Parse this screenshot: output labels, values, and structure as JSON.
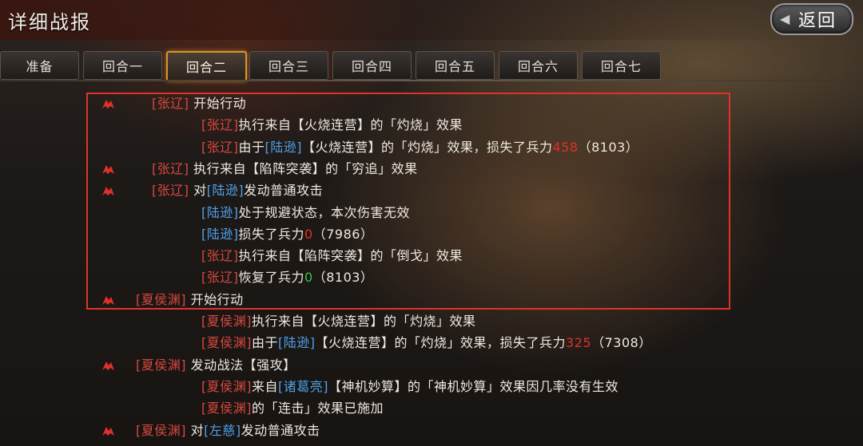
{
  "header": {
    "title": "详细战报",
    "back_label": "返回"
  },
  "tabs": [
    "准备",
    "回合一",
    "回合二",
    "回合三",
    "回合四",
    "回合五",
    "回合六",
    "回合七"
  ],
  "active_tab": 2,
  "log": [
    {
      "flag": true,
      "indent": "a",
      "parts": [
        [
          "red",
          "[张辽]"
        ],
        [
          "",
          " 开始行动"
        ]
      ]
    },
    {
      "flag": false,
      "indent": "b",
      "parts": [
        [
          "red",
          "[张辽]"
        ],
        [
          "",
          "执行来自【火烧连营】的「灼烧」效果"
        ]
      ]
    },
    {
      "flag": false,
      "indent": "b",
      "parts": [
        [
          "red",
          "[张辽]"
        ],
        [
          "",
          "由于"
        ],
        [
          "blue",
          "[陆逊]"
        ],
        [
          "",
          "【火烧连营】的「灼烧」效果，损失了兵力"
        ],
        [
          "dmg",
          "458"
        ],
        [
          "",
          "（8103）"
        ]
      ]
    },
    {
      "flag": true,
      "indent": "a",
      "parts": [
        [
          "red",
          "[张辽]"
        ],
        [
          "",
          " 执行来自【陷阵突袭】的「穷追」效果"
        ]
      ]
    },
    {
      "flag": true,
      "indent": "a",
      "parts": [
        [
          "red",
          "[张辽]"
        ],
        [
          "",
          " 对"
        ],
        [
          "blue",
          "[陆逊]"
        ],
        [
          "",
          "发动普通攻击"
        ]
      ]
    },
    {
      "flag": false,
      "indent": "b",
      "parts": [
        [
          "blue",
          "[陆逊]"
        ],
        [
          "",
          "处于规避状态，本次伤害无效"
        ]
      ]
    },
    {
      "flag": false,
      "indent": "b",
      "parts": [
        [
          "blue",
          "[陆逊]"
        ],
        [
          "",
          "损失了兵力"
        ],
        [
          "dmg",
          "0"
        ],
        [
          "",
          "（7986）"
        ]
      ]
    },
    {
      "flag": false,
      "indent": "b",
      "parts": [
        [
          "red",
          "[张辽]"
        ],
        [
          "",
          "执行来自【陷阵突袭】的「倒戈」效果"
        ]
      ]
    },
    {
      "flag": false,
      "indent": "b",
      "parts": [
        [
          "red",
          "[张辽]"
        ],
        [
          "",
          "恢复了兵力"
        ],
        [
          "heal",
          "0"
        ],
        [
          "",
          "（8103）"
        ]
      ]
    },
    {
      "flag": true,
      "indent": "c",
      "parts": [
        [
          "red",
          "[夏侯渊]"
        ],
        [
          "",
          " 开始行动"
        ]
      ]
    },
    {
      "flag": false,
      "indent": "b",
      "parts": [
        [
          "red",
          "[夏侯渊]"
        ],
        [
          "",
          "执行来自【火烧连营】的「灼烧」效果"
        ]
      ]
    },
    {
      "flag": false,
      "indent": "b",
      "parts": [
        [
          "red",
          "[夏侯渊]"
        ],
        [
          "",
          "由于"
        ],
        [
          "blue",
          "[陆逊]"
        ],
        [
          "",
          "【火烧连营】的「灼烧」效果，损失了兵力"
        ],
        [
          "dmg",
          "325"
        ],
        [
          "",
          "（7308）"
        ]
      ]
    },
    {
      "flag": true,
      "indent": "c",
      "parts": [
        [
          "red",
          "[夏侯渊]"
        ],
        [
          "",
          " 发动战法【强攻】"
        ]
      ]
    },
    {
      "flag": false,
      "indent": "b",
      "parts": [
        [
          "red",
          "[夏侯渊]"
        ],
        [
          "",
          "来自"
        ],
        [
          "blue",
          "[诸葛亮]"
        ],
        [
          "",
          "【神机妙算】的「神机妙算」效果因几率没有生效"
        ]
      ]
    },
    {
      "flag": false,
      "indent": "b",
      "parts": [
        [
          "red",
          "[夏侯渊]"
        ],
        [
          "",
          "的「连击」效果已施加"
        ]
      ]
    },
    {
      "flag": true,
      "indent": "c",
      "parts": [
        [
          "red",
          "[夏侯渊]"
        ],
        [
          "",
          " 对"
        ],
        [
          "blue",
          "[左慈]"
        ],
        [
          "",
          "发动普通攻击"
        ]
      ]
    }
  ]
}
